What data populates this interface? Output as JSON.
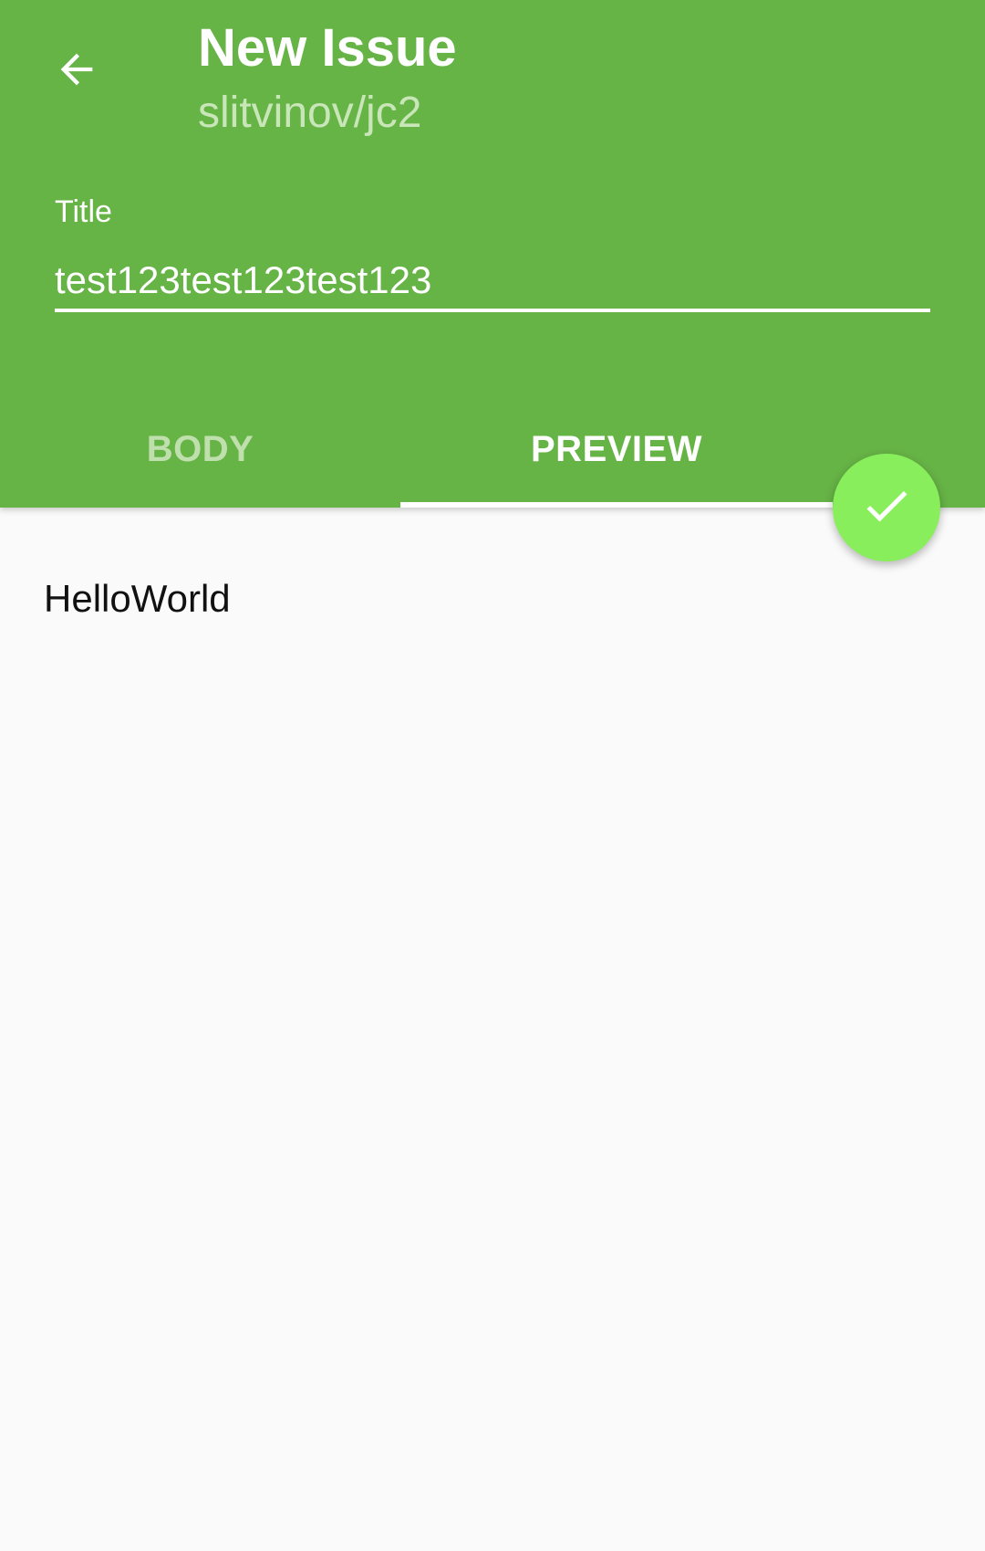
{
  "theme": {
    "primary": "#66b346",
    "accent": "#89ee5c",
    "background": "#fafafa"
  },
  "toolbar": {
    "back_icon": "arrow-left-icon",
    "title": "New Issue",
    "subtitle": "slitvinov/jc2"
  },
  "title_field": {
    "label": "Title",
    "value": "test123test123test123"
  },
  "tabs": [
    {
      "label": "BODY",
      "selected": false
    },
    {
      "label": "PREVIEW",
      "selected": true
    }
  ],
  "fab": {
    "icon": "check-icon"
  },
  "preview": {
    "text": "HelloWorld"
  }
}
